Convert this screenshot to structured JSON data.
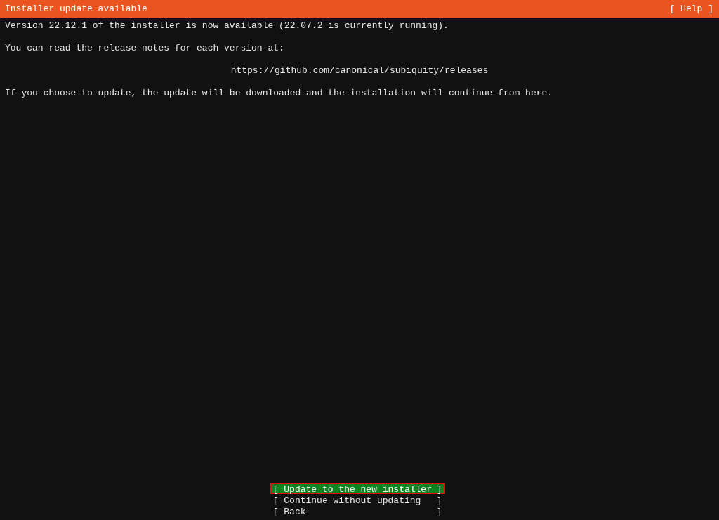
{
  "header": {
    "title": "Installer update available",
    "help": "[ Help ]"
  },
  "body": {
    "paragraphs": [
      {
        "kind": "text",
        "text": "Version 22.12.1 of the installer is now available (22.07.2 is currently running)."
      },
      {
        "kind": "text",
        "text": "You can read the release notes for each version at:"
      },
      {
        "kind": "link",
        "text": "https://github.com/canonical/subiquity/releases"
      },
      {
        "kind": "text",
        "text": "If you choose to update, the update will be downloaded and the installation will continue from here."
      }
    ]
  },
  "buttons": [
    {
      "left": "[",
      "label": "Update to the new installer",
      "right": "]",
      "selected": true
    },
    {
      "left": "[",
      "label": "Continue without updating",
      "right": "]",
      "selected": false
    },
    {
      "left": "[",
      "label": "Back",
      "right": "]",
      "selected": false
    }
  ]
}
